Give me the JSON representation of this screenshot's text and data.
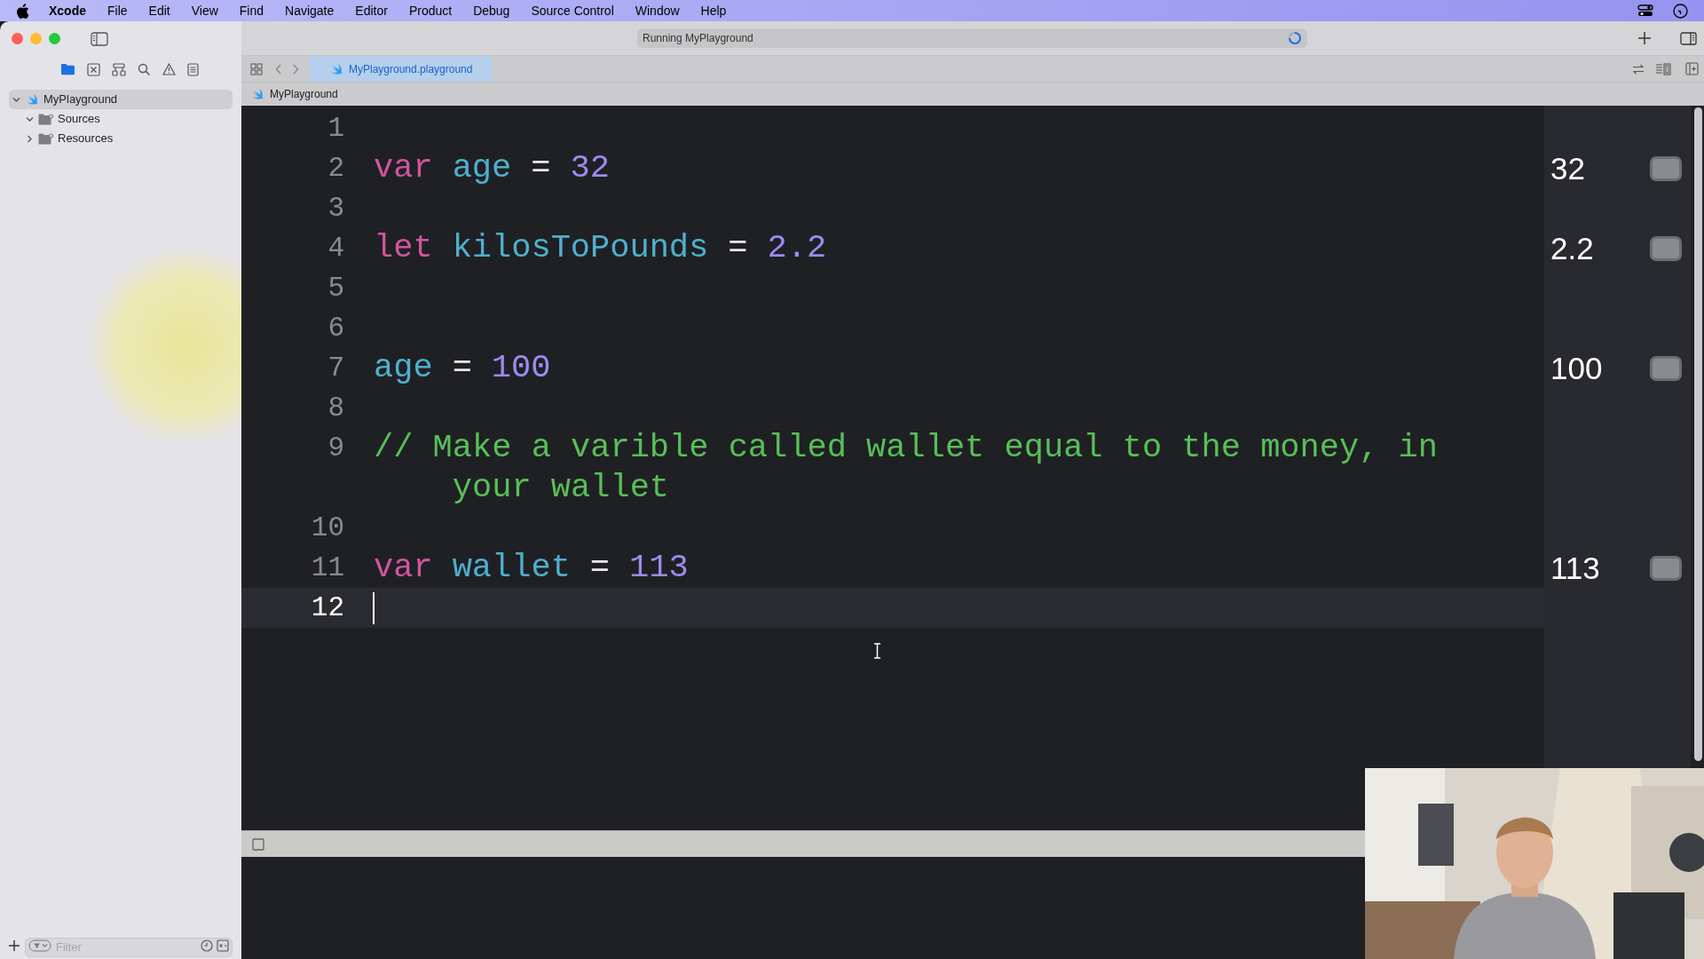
{
  "menu_bar": {
    "items": [
      {
        "label": "Xcode",
        "kind": "app"
      },
      {
        "label": "File",
        "kind": "menu"
      },
      {
        "label": "Edit",
        "kind": "menu"
      },
      {
        "label": "View",
        "kind": "menu"
      },
      {
        "label": "Find",
        "kind": "menu"
      },
      {
        "label": "Navigate",
        "kind": "menu"
      },
      {
        "label": "Editor",
        "kind": "menu"
      },
      {
        "label": "Product",
        "kind": "menu"
      },
      {
        "label": "Debug",
        "kind": "menu"
      },
      {
        "label": "Source Control",
        "kind": "menu"
      },
      {
        "label": "Window",
        "kind": "menu"
      },
      {
        "label": "Help",
        "kind": "menu"
      }
    ]
  },
  "toolbar": {
    "activity": "Running MyPlayground"
  },
  "navigator": {
    "tree": [
      {
        "label": "MyPlayground",
        "kind": "playground",
        "expanded": true,
        "selected": true,
        "children": [
          {
            "label": "Sources",
            "kind": "folder",
            "expanded": true,
            "selected": false
          },
          {
            "label": "Resources",
            "kind": "folder",
            "expanded": false,
            "selected": false
          }
        ]
      }
    ],
    "filter": {
      "placeholder": "Filter"
    }
  },
  "tabs": [
    {
      "label": "MyPlayground.playground",
      "selected": true
    }
  ],
  "jump_bar": {
    "path": [
      "MyPlayground"
    ]
  },
  "editor": {
    "lines": [
      {
        "number": "1",
        "current": false
      },
      {
        "number": "2",
        "current": false,
        "tokens": [
          {
            "text": "var",
            "kind": "keyword"
          },
          {
            "text": "age",
            "kind": "identifier"
          },
          {
            "text": "=",
            "kind": "operator"
          },
          {
            "text": "32",
            "kind": "number"
          }
        ],
        "result": "32"
      },
      {
        "number": "3",
        "current": false
      },
      {
        "number": "4",
        "current": false,
        "tokens": [
          {
            "text": "let",
            "kind": "keyword"
          },
          {
            "text": "kilosToPounds",
            "kind": "identifier"
          },
          {
            "text": "=",
            "kind": "operator"
          },
          {
            "text": "2.2",
            "kind": "number"
          }
        ],
        "result": "2.2"
      },
      {
        "number": "5",
        "current": false
      },
      {
        "number": "6",
        "current": false
      },
      {
        "number": "7",
        "current": false,
        "tokens": [
          {
            "text": "age",
            "kind": "identifier"
          },
          {
            "text": "=",
            "kind": "operator"
          },
          {
            "text": "100",
            "kind": "number"
          }
        ],
        "result": "100"
      },
      {
        "number": "8",
        "current": false
      },
      {
        "number": "9",
        "current": false,
        "tokens": [
          {
            "text": "// Make a varible called wallet equal to the money, in your wallet",
            "kind": "comment"
          }
        ]
      },
      {
        "number": "10",
        "current": false
      },
      {
        "number": "11",
        "current": false,
        "tokens": [
          {
            "text": "var",
            "kind": "keyword"
          },
          {
            "text": "wallet",
            "kind": "identifier"
          },
          {
            "text": "=",
            "kind": "operator"
          },
          {
            "text": "113",
            "kind": "number"
          }
        ],
        "result": "113"
      },
      {
        "number": "12",
        "current": true
      }
    ]
  }
}
